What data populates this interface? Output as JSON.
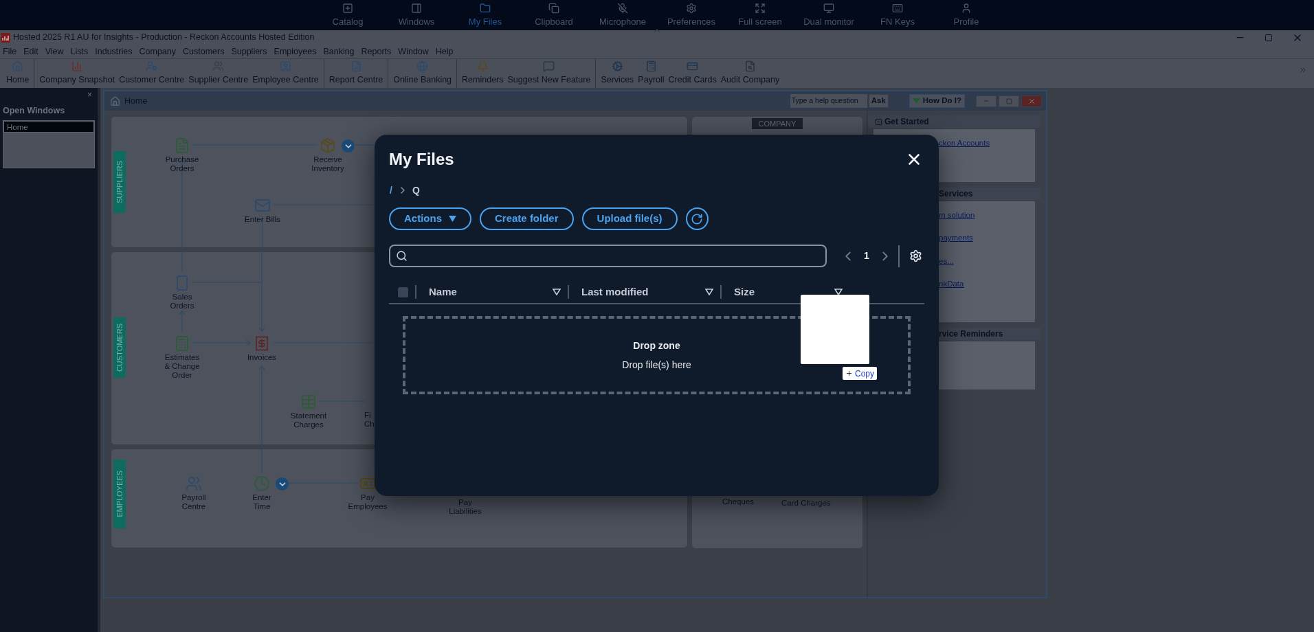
{
  "top_bar": {
    "items": [
      {
        "label": "Catalog",
        "selected": false
      },
      {
        "label": "Windows",
        "selected": false
      },
      {
        "label": "My Files",
        "selected": true
      },
      {
        "label": "Clipboard",
        "selected": false
      },
      {
        "label": "Microphone",
        "selected": false
      },
      {
        "label": "Preferences",
        "selected": false
      },
      {
        "label": "Full screen",
        "selected": false
      },
      {
        "label": "Dual monitor",
        "selected": false
      },
      {
        "label": "FN Keys",
        "selected": false
      },
      {
        "label": "Profile",
        "selected": false
      }
    ]
  },
  "window": {
    "title": "Hosted 2025 R1 AU for Insights - Production - Reckon Accounts Hosted Edition"
  },
  "menu": [
    "File",
    "Edit",
    "View",
    "Lists",
    "Industries",
    "Company",
    "Customers",
    "Suppliers",
    "Employees",
    "Banking",
    "Reports",
    "Window",
    "Help"
  ],
  "toolbar": [
    {
      "items": [
        "Home"
      ]
    },
    {
      "items": [
        "Company Snapshot",
        "Customer Centre",
        "Supplier Centre",
        "Employee Centre"
      ]
    },
    {
      "items": [
        "Report Centre"
      ]
    },
    {
      "items": [
        "Online Banking"
      ]
    },
    {
      "items": [
        "Reminders",
        "Suggest New Feature"
      ]
    },
    {
      "items": [
        "Services",
        "Payroll",
        "Credit Cards",
        "Audit Company"
      ]
    }
  ],
  "open_windows": {
    "title": "Open Windows",
    "close": "×",
    "items": [
      {
        "label": "Home",
        "selected": true
      }
    ]
  },
  "home": {
    "title": "Home",
    "help_placeholder": "Type a help question",
    "ask": "Ask",
    "how_do_i": "How Do I?",
    "sections": [
      {
        "label": "SUPPLIERS",
        "nodes": [
          {
            "lines": [
              "Purchase",
              "Orders"
            ],
            "kind": "icon",
            "has_menu": false
          },
          {
            "lines": [
              "Receive",
              "Inventory"
            ],
            "kind": "icon",
            "has_menu": true
          },
          {
            "lines": [
              "Enter Bills"
            ],
            "kind": "icon",
            "has_menu": false
          }
        ]
      },
      {
        "label": "CUSTOMERS",
        "nodes": [
          {
            "lines": [
              "Sales",
              "Orders"
            ],
            "kind": "icon",
            "has_menu": false
          },
          {
            "lines": [
              "Estimates",
              "& Change",
              "Order"
            ],
            "kind": "icon",
            "has_menu": false
          },
          {
            "lines": [
              "Invoices"
            ],
            "kind": "icon",
            "has_menu": false
          },
          {
            "lines": [
              "Statement",
              "Charges"
            ],
            "kind": "icon",
            "has_menu": false
          },
          {
            "lines": [
              "Fi",
              "Ch"
            ],
            "kind": "label",
            "has_menu": false
          }
        ]
      },
      {
        "label": "EMPLOYEES",
        "nodes": [
          {
            "lines": [
              "Payroll",
              "Centre"
            ],
            "kind": "icon",
            "has_menu": false
          },
          {
            "lines": [
              "Enter",
              "Time"
            ],
            "kind": "icon",
            "has_menu": true
          },
          {
            "lines": [
              "Pay",
              "Employees"
            ],
            "kind": "icon",
            "has_menu": false
          },
          {
            "lines": [
              "Pay",
              "Liabilities"
            ],
            "kind": "label",
            "has_menu": false
          }
        ]
      }
    ],
    "company": {
      "label": "COMPANY",
      "items": [
        "Cheques",
        "Card Charges"
      ]
    },
    "side_panels": [
      {
        "title": "Get Started",
        "links": [
          "ckon Accounts"
        ]
      },
      {
        "title": "Services",
        "links": [
          "m solution",
          "payments",
          "es...",
          "nkData"
        ]
      },
      {
        "title": "rvice Reminders"
      }
    ]
  },
  "modal": {
    "title": "My Files",
    "breadcrumb": [
      "/",
      "Q"
    ],
    "buttons": [
      {
        "label": "Actions",
        "kind": "dropdown"
      },
      {
        "label": "Create folder",
        "kind": "plain"
      },
      {
        "label": "Upload file(s)",
        "kind": "plain"
      }
    ],
    "page": "1",
    "select_all": {
      "checked": false
    },
    "columns": [
      {
        "label": "Name"
      },
      {
        "label": "Last modified"
      },
      {
        "label": "Size"
      }
    ],
    "drop_zone": {
      "title": "Drop zone",
      "hint": "Drop file(s) here"
    },
    "drag_preview": {
      "label": "Copy"
    }
  }
}
